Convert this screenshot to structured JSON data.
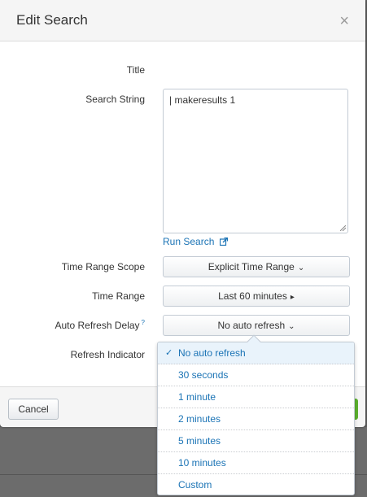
{
  "dialog": {
    "title": "Edit Search",
    "close_glyph": "×"
  },
  "form": {
    "title_label": "Title",
    "search_string_label": "Search String",
    "search_string_value": "| makeresults 1",
    "run_search_label": "Run Search",
    "time_range_scope_label": "Time Range Scope",
    "time_range_scope_value": "Explicit Time Range",
    "time_range_label": "Time Range",
    "time_range_value": "Last 60 minutes",
    "auto_refresh_delay_label": "Auto Refresh Delay",
    "auto_refresh_help": "?",
    "auto_refresh_value": "No auto refresh",
    "refresh_indicator_label": "Refresh Indicator"
  },
  "dropdown": {
    "check_glyph": "✓",
    "options": [
      {
        "label": "No auto refresh",
        "selected": true
      },
      {
        "label": "30 seconds",
        "selected": false
      },
      {
        "label": "1 minute",
        "selected": false
      },
      {
        "label": "2 minutes",
        "selected": false
      },
      {
        "label": "5 minutes",
        "selected": false
      },
      {
        "label": "10 minutes",
        "selected": false
      },
      {
        "label": "Custom",
        "selected": false
      }
    ]
  },
  "footer": {
    "cancel_label": "Cancel"
  },
  "icons": {
    "close": "close-icon",
    "dropdown_caret": "chevron-down-icon",
    "submenu_caret": "caret-right-icon",
    "external_link": "external-link-icon",
    "check": "check-icon"
  },
  "colors": {
    "link_blue": "#1a73b5",
    "selected_bg": "#e9f3fb",
    "save_green": "#5cb02e",
    "backdrop": "#5e5e5e"
  }
}
